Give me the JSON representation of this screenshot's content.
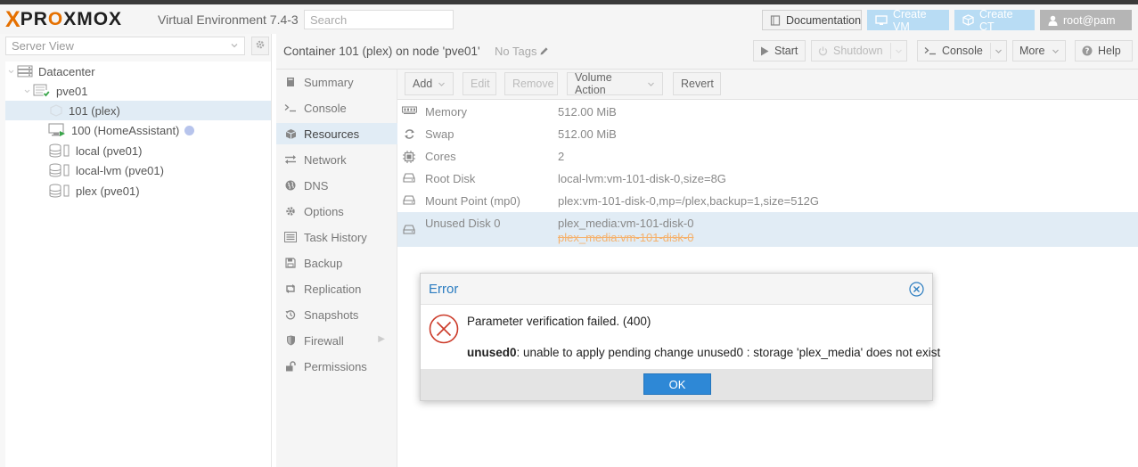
{
  "app": {
    "logo_x": "X",
    "logo_pre": "PR",
    "logo_o": "O",
    "logo_post": "XMOX",
    "version": "Virtual Environment 7.4-3",
    "search_placeholder": "Search"
  },
  "topbar": {
    "documentation": "Documentation",
    "create_vm": "Create VM",
    "create_ct": "Create CT",
    "user": "root@pam"
  },
  "left": {
    "view": "Server View",
    "tree": [
      {
        "label": "Datacenter",
        "icon": "server-icon"
      },
      {
        "label": "pve01",
        "icon": "node-icon"
      },
      {
        "label": "101 (plex)",
        "icon": "container-icon"
      },
      {
        "label": "100 (HomeAssistant)",
        "icon": "vm-icon"
      },
      {
        "label": "local (pve01)",
        "icon": "storage-icon"
      },
      {
        "label": "local-lvm (pve01)",
        "icon": "storage-icon"
      },
      {
        "label": "plex (pve01)",
        "icon": "storage-icon"
      }
    ]
  },
  "content": {
    "title": "Container 101 (plex) on node 'pve01'",
    "tags": "No Tags",
    "buttons": {
      "start": "Start",
      "shutdown": "Shutdown",
      "console": "Console",
      "more": "More",
      "help": "Help"
    }
  },
  "nav": [
    {
      "label": "Summary",
      "icon": "book-icon"
    },
    {
      "label": "Console",
      "icon": "terminal-icon"
    },
    {
      "label": "Resources",
      "icon": "cube-icon"
    },
    {
      "label": "Network",
      "icon": "exchange-icon"
    },
    {
      "label": "DNS",
      "icon": "globe-icon"
    },
    {
      "label": "Options",
      "icon": "gear-icon"
    },
    {
      "label": "Task History",
      "icon": "list-icon"
    },
    {
      "label": "Backup",
      "icon": "floppy-icon"
    },
    {
      "label": "Replication",
      "icon": "retweet-icon"
    },
    {
      "label": "Snapshots",
      "icon": "history-icon"
    },
    {
      "label": "Firewall",
      "icon": "shield-icon"
    },
    {
      "label": "Permissions",
      "icon": "unlock-icon"
    }
  ],
  "resources": {
    "toolbar": {
      "add": "Add",
      "edit": "Edit",
      "remove": "Remove",
      "volume_action": "Volume Action",
      "revert": "Revert"
    },
    "rows": [
      {
        "label": "Memory",
        "value": "512.00 MiB",
        "icon": "memory-icon"
      },
      {
        "label": "Swap",
        "value": "512.00 MiB",
        "icon": "refresh-icon"
      },
      {
        "label": "Cores",
        "value": "2",
        "icon": "cpu-icon"
      },
      {
        "label": "Root Disk",
        "value": "local-lvm:vm-101-disk-0,size=8G",
        "icon": "hdd-icon"
      },
      {
        "label": "Mount Point (mp0)",
        "value": "plex:vm-101-disk-0,mp=/plex,backup=1,size=512G",
        "icon": "hdd-icon"
      },
      {
        "label": "Unused Disk 0",
        "value": "plex_media:vm-101-disk-0",
        "pending_removed": "plex_media:vm-101-disk-0",
        "icon": "hdd-icon"
      }
    ]
  },
  "dialog": {
    "title": "Error",
    "message": "Parameter verification failed. (400)",
    "detail_key": "unused0",
    "detail_text": ": unable to apply pending change unused0 : storage 'plex_media' does not exist",
    "ok": "OK"
  }
}
